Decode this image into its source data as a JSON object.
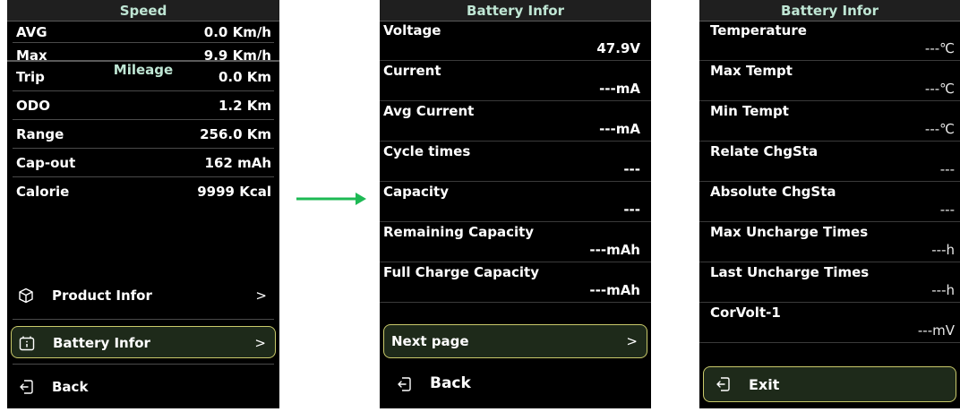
{
  "colors": {
    "accent_text": "#bfe6d4",
    "highlight_border": "#c9c96a",
    "arrow": "#1db954",
    "background": "#000000"
  },
  "screen1": {
    "header": "Speed",
    "speed_rows": [
      {
        "label": "AVG",
        "value": "0.0  Km/h"
      },
      {
        "label": "Max",
        "value": "9.9  Km/h"
      }
    ],
    "mileage_header": "Mileage",
    "mileage_rows": [
      {
        "label": "Trip",
        "value": "0.0  Km"
      },
      {
        "label": "ODO",
        "value": "1.2  Km"
      },
      {
        "label": "Range",
        "value": "256.0  Km"
      },
      {
        "label": "Cap-out",
        "value": "162  mAh"
      },
      {
        "label": "Calorie",
        "value": "9999  Kcal"
      }
    ],
    "menu": [
      {
        "label": "Product Infor",
        "chevron": ">",
        "icon": "cube-icon"
      },
      {
        "label": "Battery Infor",
        "chevron": ">",
        "icon": "battery-info-icon",
        "selected": true
      },
      {
        "label": "Back",
        "icon": "back-icon"
      }
    ]
  },
  "screen2": {
    "header": "Battery Infor",
    "rows": [
      {
        "label": "Voltage",
        "value": "47.9V"
      },
      {
        "label": "Current",
        "value": "---mA"
      },
      {
        "label": "Avg Current",
        "value": "---mA"
      },
      {
        "label": "Cycle times",
        "value": "---"
      },
      {
        "label": "Capacity",
        "value": "---"
      },
      {
        "label": "Remaining Capacity",
        "value": "---mAh"
      },
      {
        "label": "Full Charge Capacity",
        "value": "---mAh"
      }
    ],
    "next_page": {
      "label": "Next page",
      "chevron": ">"
    },
    "back": {
      "label": "Back",
      "icon": "back-icon"
    }
  },
  "screen3": {
    "header": "Battery Infor",
    "rows": [
      {
        "label": "Temperature",
        "value": "---℃"
      },
      {
        "label": "Max Tempt",
        "value": "---℃"
      },
      {
        "label": "Min Tempt",
        "value": "---℃"
      },
      {
        "label": "Relate ChgSta",
        "value": "---"
      },
      {
        "label": "Absolute ChgSta",
        "value": "---"
      },
      {
        "label": "Max Uncharge Times",
        "value": "---h"
      },
      {
        "label": "Last Uncharge Times",
        "value": "---h"
      },
      {
        "label": "CorVolt-1",
        "value": "---mV"
      }
    ],
    "exit": {
      "label": "Exit",
      "icon": "exit-icon"
    }
  }
}
